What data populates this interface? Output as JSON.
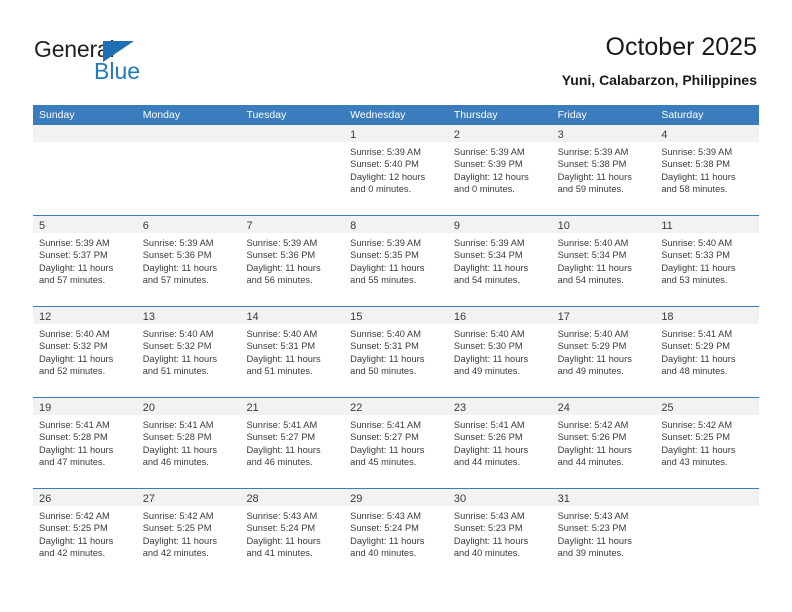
{
  "logo": {
    "word1": "General",
    "word2": "Blue",
    "triangle_color": "#1f6fb4",
    "blue_color": "#1f7ac0"
  },
  "header": {
    "title": "October 2025",
    "subtitle": "Yuni, Calabarzon, Philippines"
  },
  "theme": {
    "header_blue": "#3a7cbe",
    "day_band_gray": "#f2f2f2",
    "text_color": "#3b3b3b"
  },
  "weekdays": [
    "Sunday",
    "Monday",
    "Tuesday",
    "Wednesday",
    "Thursday",
    "Friday",
    "Saturday"
  ],
  "labels": {
    "sunrise": "Sunrise:",
    "sunset": "Sunset:",
    "daylight": "Daylight:"
  },
  "weeks": [
    [
      {
        "day": "",
        "empty": true
      },
      {
        "day": "",
        "empty": true
      },
      {
        "day": "",
        "empty": true
      },
      {
        "day": "1",
        "sunrise": "Sunrise: 5:39 AM",
        "sunset": "Sunset: 5:40 PM",
        "daylight": "Daylight: 12 hours and 0 minutes."
      },
      {
        "day": "2",
        "sunrise": "Sunrise: 5:39 AM",
        "sunset": "Sunset: 5:39 PM",
        "daylight": "Daylight: 12 hours and 0 minutes."
      },
      {
        "day": "3",
        "sunrise": "Sunrise: 5:39 AM",
        "sunset": "Sunset: 5:38 PM",
        "daylight": "Daylight: 11 hours and 59 minutes."
      },
      {
        "day": "4",
        "sunrise": "Sunrise: 5:39 AM",
        "sunset": "Sunset: 5:38 PM",
        "daylight": "Daylight: 11 hours and 58 minutes."
      }
    ],
    [
      {
        "day": "5",
        "sunrise": "Sunrise: 5:39 AM",
        "sunset": "Sunset: 5:37 PM",
        "daylight": "Daylight: 11 hours and 57 minutes."
      },
      {
        "day": "6",
        "sunrise": "Sunrise: 5:39 AM",
        "sunset": "Sunset: 5:36 PM",
        "daylight": "Daylight: 11 hours and 57 minutes."
      },
      {
        "day": "7",
        "sunrise": "Sunrise: 5:39 AM",
        "sunset": "Sunset: 5:36 PM",
        "daylight": "Daylight: 11 hours and 56 minutes."
      },
      {
        "day": "8",
        "sunrise": "Sunrise: 5:39 AM",
        "sunset": "Sunset: 5:35 PM",
        "daylight": "Daylight: 11 hours and 55 minutes."
      },
      {
        "day": "9",
        "sunrise": "Sunrise: 5:39 AM",
        "sunset": "Sunset: 5:34 PM",
        "daylight": "Daylight: 11 hours and 54 minutes."
      },
      {
        "day": "10",
        "sunrise": "Sunrise: 5:40 AM",
        "sunset": "Sunset: 5:34 PM",
        "daylight": "Daylight: 11 hours and 54 minutes."
      },
      {
        "day": "11",
        "sunrise": "Sunrise: 5:40 AM",
        "sunset": "Sunset: 5:33 PM",
        "daylight": "Daylight: 11 hours and 53 minutes."
      }
    ],
    [
      {
        "day": "12",
        "sunrise": "Sunrise: 5:40 AM",
        "sunset": "Sunset: 5:32 PM",
        "daylight": "Daylight: 11 hours and 52 minutes."
      },
      {
        "day": "13",
        "sunrise": "Sunrise: 5:40 AM",
        "sunset": "Sunset: 5:32 PM",
        "daylight": "Daylight: 11 hours and 51 minutes."
      },
      {
        "day": "14",
        "sunrise": "Sunrise: 5:40 AM",
        "sunset": "Sunset: 5:31 PM",
        "daylight": "Daylight: 11 hours and 51 minutes."
      },
      {
        "day": "15",
        "sunrise": "Sunrise: 5:40 AM",
        "sunset": "Sunset: 5:31 PM",
        "daylight": "Daylight: 11 hours and 50 minutes."
      },
      {
        "day": "16",
        "sunrise": "Sunrise: 5:40 AM",
        "sunset": "Sunset: 5:30 PM",
        "daylight": "Daylight: 11 hours and 49 minutes."
      },
      {
        "day": "17",
        "sunrise": "Sunrise: 5:40 AM",
        "sunset": "Sunset: 5:29 PM",
        "daylight": "Daylight: 11 hours and 49 minutes."
      },
      {
        "day": "18",
        "sunrise": "Sunrise: 5:41 AM",
        "sunset": "Sunset: 5:29 PM",
        "daylight": "Daylight: 11 hours and 48 minutes."
      }
    ],
    [
      {
        "day": "19",
        "sunrise": "Sunrise: 5:41 AM",
        "sunset": "Sunset: 5:28 PM",
        "daylight": "Daylight: 11 hours and 47 minutes."
      },
      {
        "day": "20",
        "sunrise": "Sunrise: 5:41 AM",
        "sunset": "Sunset: 5:28 PM",
        "daylight": "Daylight: 11 hours and 46 minutes."
      },
      {
        "day": "21",
        "sunrise": "Sunrise: 5:41 AM",
        "sunset": "Sunset: 5:27 PM",
        "daylight": "Daylight: 11 hours and 46 minutes."
      },
      {
        "day": "22",
        "sunrise": "Sunrise: 5:41 AM",
        "sunset": "Sunset: 5:27 PM",
        "daylight": "Daylight: 11 hours and 45 minutes."
      },
      {
        "day": "23",
        "sunrise": "Sunrise: 5:41 AM",
        "sunset": "Sunset: 5:26 PM",
        "daylight": "Daylight: 11 hours and 44 minutes."
      },
      {
        "day": "24",
        "sunrise": "Sunrise: 5:42 AM",
        "sunset": "Sunset: 5:26 PM",
        "daylight": "Daylight: 11 hours and 44 minutes."
      },
      {
        "day": "25",
        "sunrise": "Sunrise: 5:42 AM",
        "sunset": "Sunset: 5:25 PM",
        "daylight": "Daylight: 11 hours and 43 minutes."
      }
    ],
    [
      {
        "day": "26",
        "sunrise": "Sunrise: 5:42 AM",
        "sunset": "Sunset: 5:25 PM",
        "daylight": "Daylight: 11 hours and 42 minutes."
      },
      {
        "day": "27",
        "sunrise": "Sunrise: 5:42 AM",
        "sunset": "Sunset: 5:25 PM",
        "daylight": "Daylight: 11 hours and 42 minutes."
      },
      {
        "day": "28",
        "sunrise": "Sunrise: 5:43 AM",
        "sunset": "Sunset: 5:24 PM",
        "daylight": "Daylight: 11 hours and 41 minutes."
      },
      {
        "day": "29",
        "sunrise": "Sunrise: 5:43 AM",
        "sunset": "Sunset: 5:24 PM",
        "daylight": "Daylight: 11 hours and 40 minutes."
      },
      {
        "day": "30",
        "sunrise": "Sunrise: 5:43 AM",
        "sunset": "Sunset: 5:23 PM",
        "daylight": "Daylight: 11 hours and 40 minutes."
      },
      {
        "day": "31",
        "sunrise": "Sunrise: 5:43 AM",
        "sunset": "Sunset: 5:23 PM",
        "daylight": "Daylight: 11 hours and 39 minutes."
      },
      {
        "day": "",
        "empty": true
      }
    ]
  ]
}
